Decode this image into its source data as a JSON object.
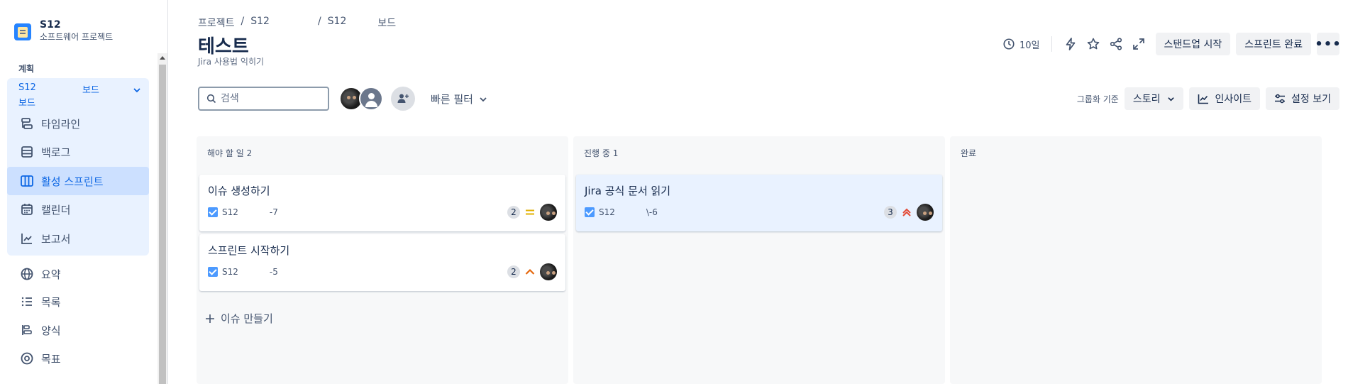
{
  "project": {
    "name": "S12",
    "type": "소프트웨어 프로젝트"
  },
  "sidebar": {
    "section_label": "계획",
    "board_selector": {
      "line1_a": "S12",
      "line1_b": "보드",
      "line2": "보드"
    },
    "items": [
      {
        "label": "타임라인",
        "icon": "timeline-icon"
      },
      {
        "label": "백로그",
        "icon": "backlog-icon"
      },
      {
        "label": "활성 스프린트",
        "icon": "board-icon",
        "active": true
      },
      {
        "label": "캘린더",
        "icon": "calendar-icon"
      },
      {
        "label": "보고서",
        "icon": "reports-icon"
      },
      {
        "label": "요약",
        "icon": "globe-icon"
      },
      {
        "label": "목록",
        "icon": "list-icon"
      },
      {
        "label": "양식",
        "icon": "form-icon"
      },
      {
        "label": "목표",
        "icon": "target-icon"
      }
    ]
  },
  "breadcrumb": [
    "프로젝트",
    "/",
    "S12",
    "/",
    "S12",
    "보드"
  ],
  "page": {
    "title": "테스트",
    "subtitle": "Jira 사용법 익히기"
  },
  "top_actions": {
    "days_remaining": "10일",
    "standup_label": "스탠드업 시작",
    "complete_sprint_label": "스프린트 완료",
    "more_label": "•••"
  },
  "toolbar": {
    "search_placeholder": "검색",
    "quick_filter_label": "빠른 필터",
    "group_by_label": "그룹화 기준",
    "group_by_value": "스토리",
    "insights_label": "인사이트",
    "view_settings_label": "설정 보기"
  },
  "columns": [
    {
      "title": "해야 할 일 2",
      "cards": [
        {
          "title": "이슈 생성하기",
          "project": "S12",
          "key": "-7",
          "points": "2",
          "priority": "medium"
        },
        {
          "title": "스프린트 시작하기",
          "project": "S12",
          "key": "-5",
          "points": "2",
          "priority": "high"
        }
      ],
      "create_label": "이슈 만들기"
    },
    {
      "title": "진행 중 1",
      "cards": [
        {
          "title": "Jira 공식 문서 읽기",
          "project": "S12",
          "key": "\\-6",
          "points": "3",
          "priority": "highest"
        }
      ]
    },
    {
      "title": "완료",
      "cards": []
    }
  ],
  "colors": {
    "accent": "#0c66e4",
    "active_bg": "#cce0ff",
    "plan_bg": "#e9f2ff",
    "priority_medium": "#e2b203",
    "priority_high": "#e56910",
    "priority_highest": "#e34935"
  }
}
